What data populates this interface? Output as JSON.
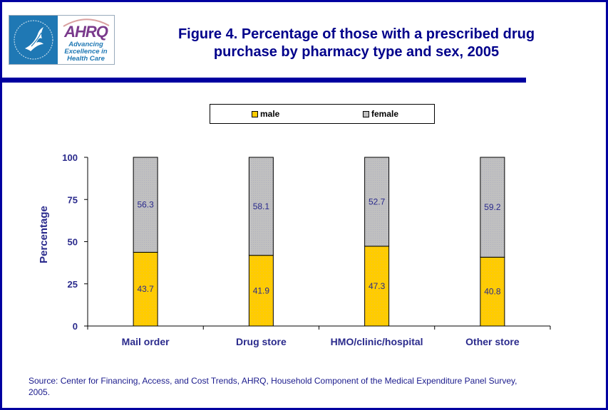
{
  "header": {
    "logo_left_alt": "Department of Health & Human Services USA",
    "logo_word": "AHRQ",
    "logo_tagline": [
      "Advancing",
      "Excellence in",
      "Health Care"
    ],
    "title_line1": "Figure 4. Percentage of those with a prescribed drug",
    "title_line2": "purchase by pharmacy type and sex, 2005"
  },
  "colors": {
    "frame": "#0000A0",
    "title": "#00008B",
    "male": "#FFCC00",
    "female": "#C0C0C0",
    "text": "#2A2A8C"
  },
  "chart_data": {
    "type": "bar",
    "stacked": true,
    "title": "Figure 4. Percentage of those with a prescribed drug purchase by pharmacy type and sex, 2005",
    "xlabel": "",
    "ylabel": "Percentage",
    "ylim": [
      0,
      100
    ],
    "yticks": [
      0,
      25,
      50,
      75,
      100
    ],
    "categories": [
      "Mail order",
      "Drug store",
      "HMO/clinic/hospital",
      "Other store"
    ],
    "series": [
      {
        "name": "male",
        "color": "#FFCC00",
        "values": [
          43.7,
          41.9,
          47.3,
          40.8
        ]
      },
      {
        "name": "female",
        "color": "#C0C0C0",
        "values": [
          56.3,
          58.1,
          52.7,
          59.2
        ]
      }
    ],
    "legend": {
      "position": "top",
      "entries": [
        "male",
        "female"
      ]
    },
    "grid": false
  },
  "footer": {
    "source_line1": "Source: Center for Financing, Access, and Cost Trends, AHRQ, Household Component of the Medical Expenditure Panel Survey,",
    "source_line2": "2005."
  }
}
